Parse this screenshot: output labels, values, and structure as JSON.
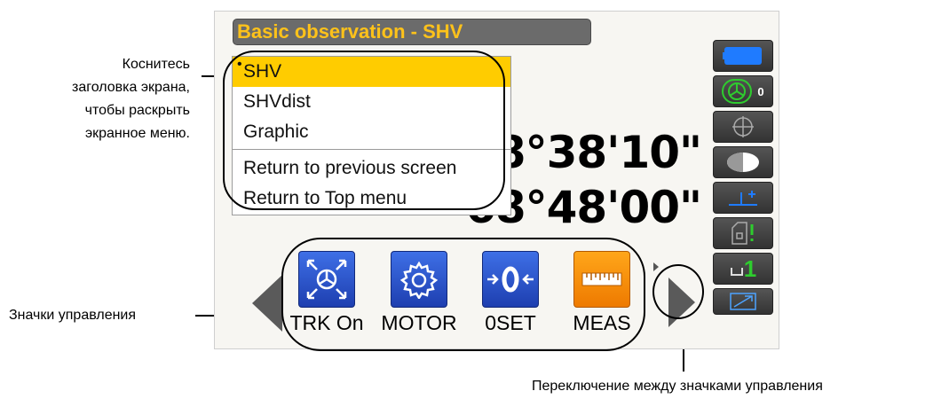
{
  "screen": {
    "title": "Basic observation - SHV",
    "menu": {
      "items": [
        {
          "label": "SHV",
          "selected": true
        },
        {
          "label": "SHVdist",
          "selected": false
        },
        {
          "label": "Graphic",
          "selected": false
        }
      ],
      "actions": [
        {
          "label": "Return to previous screen"
        },
        {
          "label": "Return to Top menu"
        }
      ],
      "selected_marker": "•"
    },
    "angles": {
      "upper": "68°38'10\"",
      "lower": "68°48'00\""
    },
    "side_buttons": [
      {
        "icon": "battery-icon",
        "value": ""
      },
      {
        "icon": "prism-target-icon",
        "value": "0"
      },
      {
        "icon": "crosshair-icon",
        "value": ""
      },
      {
        "icon": "half-circle-icon",
        "value": ""
      },
      {
        "icon": "tilt-correction-icon",
        "value": ""
      },
      {
        "icon": "tilt-sensor-icon",
        "value": ""
      },
      {
        "icon": "page-number-icon",
        "value": "1"
      },
      {
        "icon": "keyboard-icon",
        "value": ""
      }
    ],
    "controls": [
      {
        "icon": "tracking-icon",
        "label": "TRK On",
        "color": "#2a52d1"
      },
      {
        "icon": "gear-icon",
        "label": "MOTOR",
        "color": "#2a52d1"
      },
      {
        "icon": "zero-set-icon",
        "label": "0SET",
        "color": "#2a52d1"
      },
      {
        "icon": "measure-ruler-icon",
        "label": "MEAS",
        "color": "#f08a00"
      }
    ],
    "colors": {
      "title_text": "#ffc21a",
      "title_bg": "#6b6b6b",
      "menu_selected": "#ffcc00",
      "side_active": "#1f7bff",
      "side_green": "#2ecc2e"
    }
  },
  "callouts": {
    "menu_hint": [
      "Коснитесь",
      "заголовка экрана,",
      "чтобы раскрыть",
      "экранное меню."
    ],
    "controls_hint": "Значки управления",
    "switch_hint": "Переключение между значками управления"
  }
}
